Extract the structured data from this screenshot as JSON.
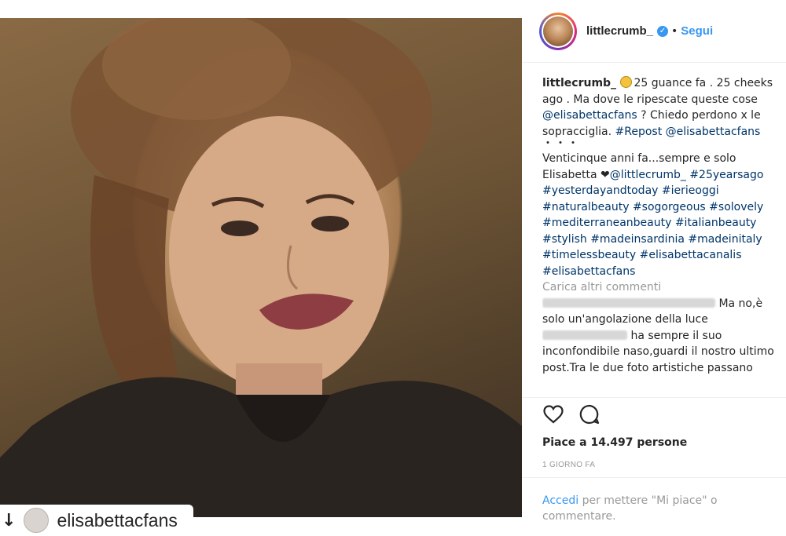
{
  "post": {
    "repost_username": "elisabettacfans",
    "image_alt_icon": "portrait-photo"
  },
  "header": {
    "username": "littlecrumb_",
    "verified_icon": "verified-badge-icon",
    "separator": "•",
    "follow_label": "Segui"
  },
  "caption": {
    "username": "littlecrumb_",
    "emoji_icon": "rofl-emoji-icon",
    "text_1": "25 guance fa . 25 cheeks ago . Ma dove le ripescate queste cose ",
    "mention_1": "@elisabettacfans",
    "text_2": " ? Chiedo perdono x le sopracciglia. ",
    "hashtag_repost": "#Repost",
    "text_3": " ",
    "mention_2": "@elisabettacfans",
    "ellipsis": "・・・",
    "text_4": "Venticinque anni fa...sempre e solo Elisabetta ",
    "heart": "❤",
    "mention_3": "@littlecrumb_",
    "tags": "#25yearsago #yesterdayandtoday #ierieoggi #naturalbeauty #sogorgeous #solovely #mediterraneanbeauty #italianbeauty #stylish #madeinsardinia #madeinitaly #timelessbeauty #elisabettacanalis #elisabettacfans"
  },
  "load_more": "Carica altri commenti",
  "comment": {
    "text_a": "Ma no,è solo un'angolazione della luce",
    "text_b": "ha sempre il suo inconfondibile naso,guardi il nostro ultimo post.Tra le due foto artistiche passano"
  },
  "actions": {
    "like_icon": "heart-outline-icon",
    "comment_icon": "comment-bubble-icon"
  },
  "likes_text": "Piace a 14.497 persone",
  "timestamp": "1 GIORNO FA",
  "login": {
    "link": "Accedi",
    "rest": " per mettere \"Mi piace\" o commentare."
  },
  "colors": {
    "link_blue": "#3897f0",
    "mention_navy": "#003569",
    "text": "#262626",
    "muted": "#999999"
  }
}
